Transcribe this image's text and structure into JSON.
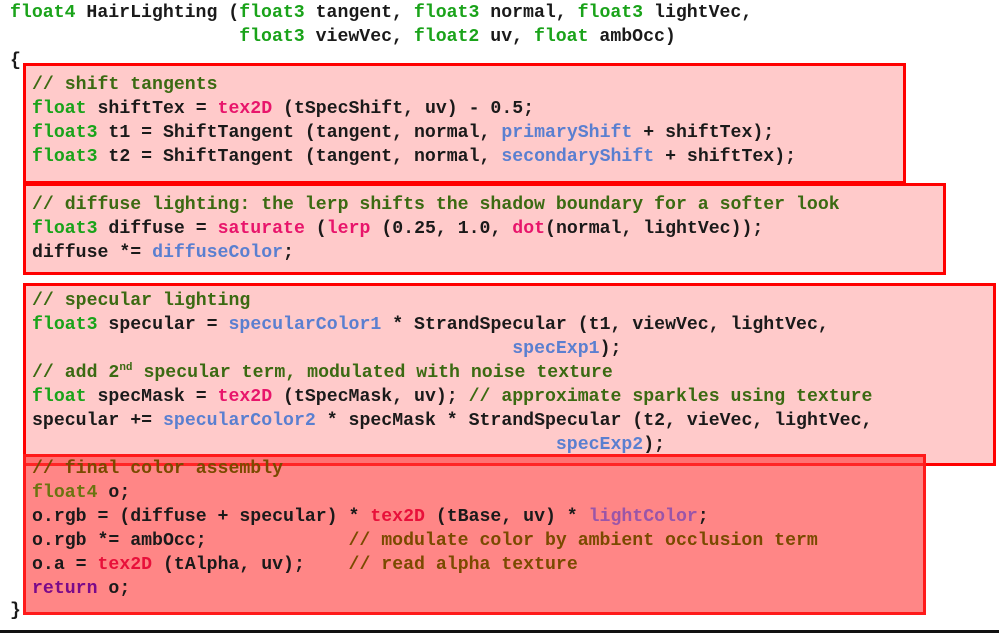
{
  "header": {
    "line1": {
      "ret_type": "float4",
      "func_name": " HairLighting (",
      "t1": "float3",
      "p1": " tangent, ",
      "t2": "float3",
      "p2": " normal, ",
      "t3": "float3",
      "p3": " lightVec,"
    },
    "line2": {
      "indent": "                     ",
      "t1": "float3",
      "p1": " viewVec, ",
      "t2": "float2",
      "p2": " uv, ",
      "t3": "float",
      "p3": " ambOcc)"
    },
    "open_brace": "{",
    "close_brace": "}"
  },
  "blocks": {
    "shift": {
      "comment": "// shift tangents",
      "l1": {
        "type": "float",
        "a": " shiftTex = ",
        "fn": "tex2D",
        "b": " (tSpecShift, uv) - 0.5;"
      },
      "l2": {
        "type": "float3",
        "a": " t1 = ShiftTangent (tangent, normal, ",
        "var": "primaryShift",
        "b": " + shiftTex);"
      },
      "l3": {
        "type": "float3",
        "a": " t2 = ShiftTangent (tangent, normal, ",
        "var": "secondaryShift",
        "b": " + shiftTex);"
      }
    },
    "diffuse": {
      "comment": "// diffuse lighting: the lerp shifts the shadow boundary for a softer look",
      "l1": {
        "type": "float3",
        "a": " diffuse = ",
        "fn1": "saturate",
        "b": " (",
        "fn2": "lerp",
        "c": " (0.25, 1.0, ",
        "fn3": "dot",
        "d": "(normal, lightVec));"
      },
      "l2": {
        "a": "diffuse *= ",
        "var": "diffuseColor",
        "b": ";"
      }
    },
    "specular": {
      "comment": "// specular lighting",
      "l1": {
        "type": "float3",
        "a": " specular = ",
        "var": "specularColor1",
        "b": " * StrandSpecular (t1, viewVec, lightVec,"
      },
      "l2": {
        "indent": "                                            ",
        "var": "specExp1",
        "b": ");"
      },
      "comment2": {
        "a": "// add 2",
        "sup": "nd",
        "b": " specular term, modulated with noise texture"
      },
      "l3": {
        "type": "float",
        "a": " specMask = ",
        "fn": "tex2D",
        "b": " (tSpecMask, uv); ",
        "cm": "// approximate sparkles using texture"
      },
      "l4": {
        "a": "specular += ",
        "var": "specularColor2",
        "b": " * specMask * StrandSpecular (t2, vieVec, lightVec,"
      },
      "l5": {
        "indent": "                                                ",
        "var": "specExp2",
        "b": ");"
      }
    },
    "final": {
      "comment": "// final color assembly",
      "l1": {
        "type": "float4",
        "a": " o;"
      },
      "l2": {
        "a": "o.rgb = (diffuse + specular) * ",
        "fn": "tex2D",
        "b": " (tBase, uv) * ",
        "var": "lightColor",
        "c": ";"
      },
      "l3": {
        "a": "o.rgb *= ambOcc;             ",
        "cm": "// modulate color by ambient occlusion term"
      },
      "l4": {
        "a": "o.a = ",
        "fn": "tex2D",
        "b": " (tAlpha, uv);    ",
        "cm": "// read alpha texture"
      },
      "l5": {
        "kw": "return",
        "a": " o;"
      }
    }
  }
}
